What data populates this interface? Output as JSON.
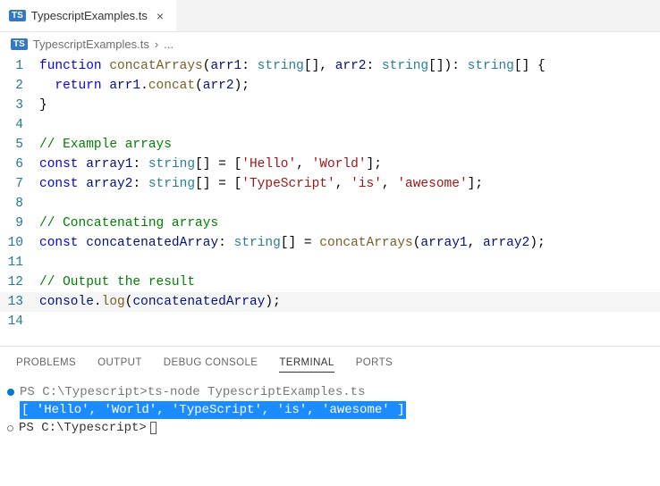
{
  "tab": {
    "badge": "TS",
    "filename": "TypescriptExamples.ts",
    "close": "×"
  },
  "breadcrumb": {
    "badge": "TS",
    "file": "TypescriptExamples.ts",
    "sep": "›",
    "rest": "..."
  },
  "code": [
    [
      {
        "c": "tk-kw",
        "t": "function"
      },
      {
        "c": "tk-def",
        "t": " "
      },
      {
        "c": "tk-fn",
        "t": "concatArrays"
      },
      {
        "c": "tk-pn",
        "t": "("
      },
      {
        "c": "tk-var",
        "t": "arr1"
      },
      {
        "c": "tk-pn",
        "t": ": "
      },
      {
        "c": "tk-type",
        "t": "string"
      },
      {
        "c": "tk-pn",
        "t": "[], "
      },
      {
        "c": "tk-var",
        "t": "arr2"
      },
      {
        "c": "tk-pn",
        "t": ": "
      },
      {
        "c": "tk-type",
        "t": "string"
      },
      {
        "c": "tk-pn",
        "t": "[]): "
      },
      {
        "c": "tk-type",
        "t": "string"
      },
      {
        "c": "tk-pn",
        "t": "[] {"
      }
    ],
    [
      {
        "c": "tk-def",
        "t": "  "
      },
      {
        "c": "tk-kw",
        "t": "return"
      },
      {
        "c": "tk-def",
        "t": " "
      },
      {
        "c": "tk-var",
        "t": "arr1"
      },
      {
        "c": "tk-pn",
        "t": "."
      },
      {
        "c": "tk-fn",
        "t": "concat"
      },
      {
        "c": "tk-pn",
        "t": "("
      },
      {
        "c": "tk-var",
        "t": "arr2"
      },
      {
        "c": "tk-pn",
        "t": ");"
      }
    ],
    [
      {
        "c": "tk-pn",
        "t": "}"
      }
    ],
    [],
    [
      {
        "c": "tk-cmt",
        "t": "// Example arrays"
      }
    ],
    [
      {
        "c": "tk-kw",
        "t": "const"
      },
      {
        "c": "tk-def",
        "t": " "
      },
      {
        "c": "tk-var",
        "t": "array1"
      },
      {
        "c": "tk-pn",
        "t": ": "
      },
      {
        "c": "tk-type",
        "t": "string"
      },
      {
        "c": "tk-pn",
        "t": "[] = ["
      },
      {
        "c": "tk-str",
        "t": "'Hello'"
      },
      {
        "c": "tk-pn",
        "t": ", "
      },
      {
        "c": "tk-str",
        "t": "'World'"
      },
      {
        "c": "tk-pn",
        "t": "];"
      }
    ],
    [
      {
        "c": "tk-kw",
        "t": "const"
      },
      {
        "c": "tk-def",
        "t": " "
      },
      {
        "c": "tk-var",
        "t": "array2"
      },
      {
        "c": "tk-pn",
        "t": ": "
      },
      {
        "c": "tk-type",
        "t": "string"
      },
      {
        "c": "tk-pn",
        "t": "[] = ["
      },
      {
        "c": "tk-str",
        "t": "'TypeScript'"
      },
      {
        "c": "tk-pn",
        "t": ", "
      },
      {
        "c": "tk-str",
        "t": "'is'"
      },
      {
        "c": "tk-pn",
        "t": ", "
      },
      {
        "c": "tk-str",
        "t": "'awesome'"
      },
      {
        "c": "tk-pn",
        "t": "];"
      }
    ],
    [],
    [
      {
        "c": "tk-cmt",
        "t": "// Concatenating arrays"
      }
    ],
    [
      {
        "c": "tk-kw",
        "t": "const"
      },
      {
        "c": "tk-def",
        "t": " "
      },
      {
        "c": "tk-var",
        "t": "concatenatedArray"
      },
      {
        "c": "tk-pn",
        "t": ": "
      },
      {
        "c": "tk-type",
        "t": "string"
      },
      {
        "c": "tk-pn",
        "t": "[] = "
      },
      {
        "c": "tk-fn",
        "t": "concatArrays"
      },
      {
        "c": "tk-pn",
        "t": "("
      },
      {
        "c": "tk-var",
        "t": "array1"
      },
      {
        "c": "tk-pn",
        "t": ", "
      },
      {
        "c": "tk-var",
        "t": "array2"
      },
      {
        "c": "tk-pn",
        "t": ");"
      }
    ],
    [],
    [
      {
        "c": "tk-cmt",
        "t": "// Output the result"
      }
    ],
    [
      {
        "c": "tk-var",
        "t": "console"
      },
      {
        "c": "tk-pn",
        "t": "."
      },
      {
        "c": "tk-fn",
        "t": "log"
      },
      {
        "c": "tk-pn",
        "t": "("
      },
      {
        "c": "tk-var",
        "t": "concatenatedArray"
      },
      {
        "c": "tk-pn",
        "t": ");"
      }
    ],
    []
  ],
  "activeLine": 13,
  "panel": {
    "tabs": [
      "PROBLEMS",
      "OUTPUT",
      "DEBUG CONSOLE",
      "TERMINAL",
      "PORTS"
    ],
    "active": 3
  },
  "terminal": {
    "prompt1_path": "PS C:\\Typescript> ",
    "prompt1_cmd": "ts-node TypescriptExamples.ts",
    "output": "[ 'Hello', 'World', 'TypeScript', 'is', 'awesome' ]",
    "prompt2": "PS C:\\Typescript> "
  }
}
